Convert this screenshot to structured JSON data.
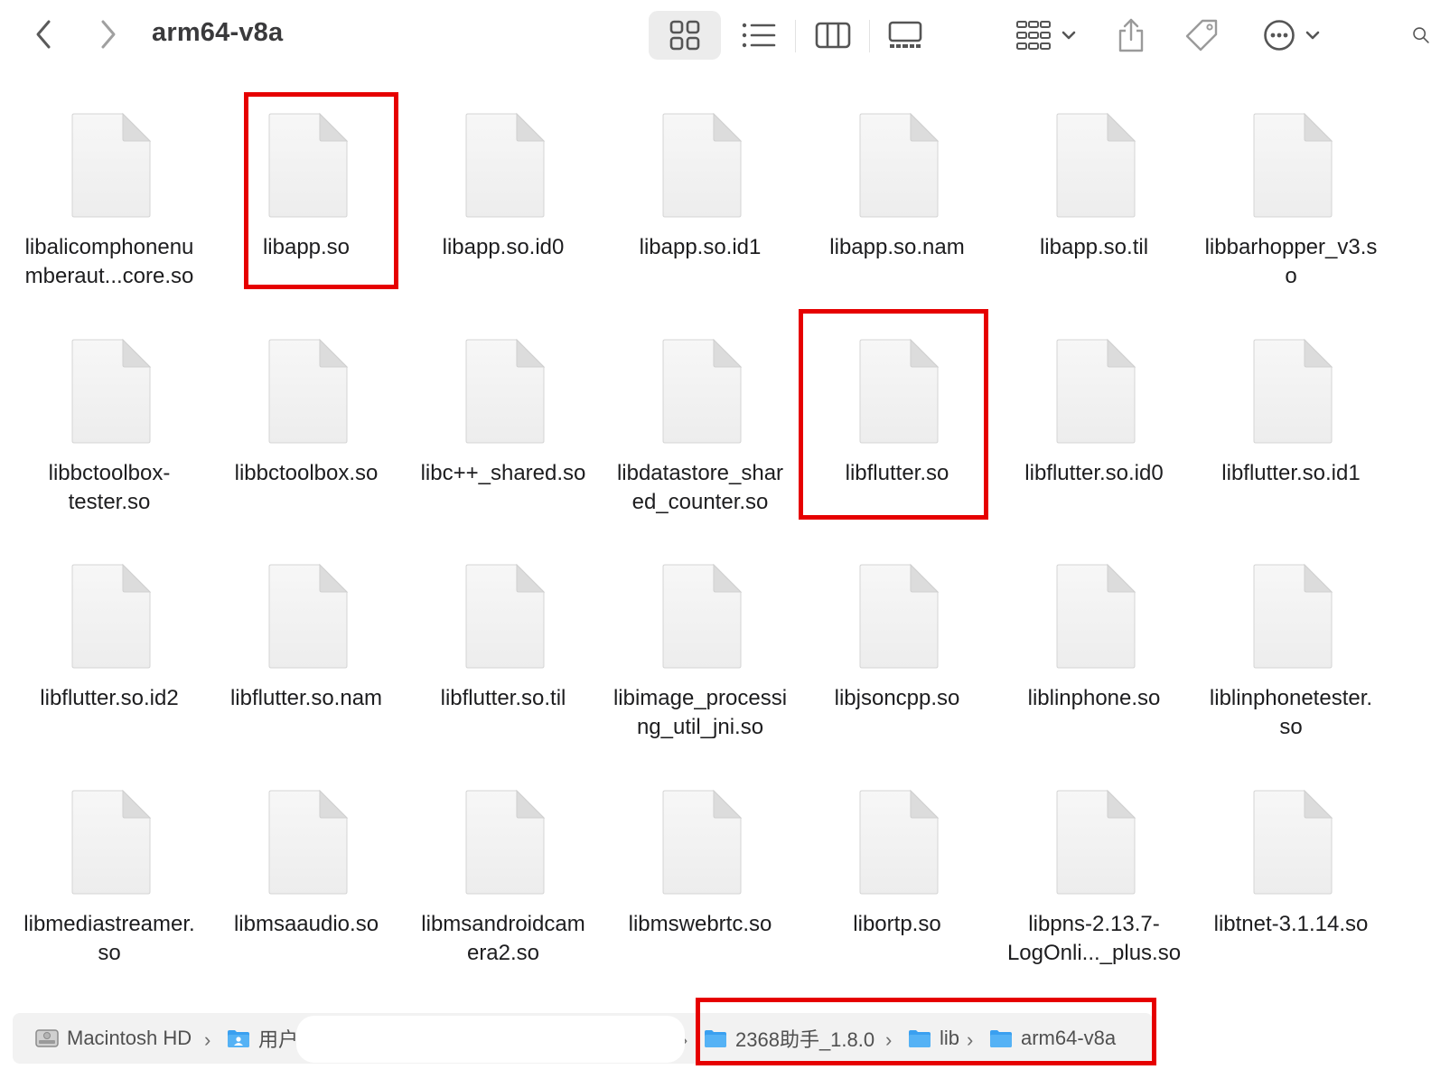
{
  "window": {
    "title": "arm64-v8a"
  },
  "toolbar": {
    "back_icon": "chevron-left-icon",
    "forward_icon": "chevron-right-icon",
    "views": [
      "icon-view",
      "list-view",
      "column-view",
      "gallery-view"
    ],
    "active_view": "icon-view",
    "group_icon": "group-grid-icon",
    "share_icon": "share-icon",
    "tag_icon": "tag-icon",
    "more_icon": "ellipsis-circle-icon",
    "search_icon": "search-icon"
  },
  "files": [
    "libalicomphonenu mberaut...core.so",
    "libapp.so",
    "libapp.so.id0",
    "libapp.so.id1",
    "libapp.so.nam",
    "libapp.so.til",
    "libbarhopper_v3.so",
    "libbctoolbox-tester.so",
    "libbctoolbox.so",
    "libc++_shared.so",
    "libdatastore_shared_counter.so",
    "libflutter.so",
    "libflutter.so.id0",
    "libflutter.so.id1",
    "libflutter.so.id2",
    "libflutter.so.nam",
    "libflutter.so.til",
    "libimage_processing_util_jni.so",
    "libjsoncpp.so",
    "liblinphone.so",
    "liblinphonetester.so",
    "libmediastreamer.so",
    "libmsaaudio.so",
    "libmsandroidcamera2.so",
    "libmswebrtc.so",
    "libortp.so",
    "libpns-2.13.7-LogOnli..._plus.so",
    "libtnet-3.1.14.so"
  ],
  "file_labels": [
    [
      "libalicomphonenu",
      "mberaut...core.so"
    ],
    [
      "libapp.so"
    ],
    [
      "libapp.so.id0"
    ],
    [
      "libapp.so.id1"
    ],
    [
      "libapp.so.nam"
    ],
    [
      "libapp.so.til"
    ],
    [
      "libbarhopper_v3.s",
      "o"
    ],
    [
      "libbctoolbox-",
      "tester.so"
    ],
    [
      "libbctoolbox.so"
    ],
    [
      "libc++_shared.so"
    ],
    [
      "libdatastore_shar",
      "ed_counter.so"
    ],
    [
      "libflutter.so"
    ],
    [
      "libflutter.so.id0"
    ],
    [
      "libflutter.so.id1"
    ],
    [
      "libflutter.so.id2"
    ],
    [
      "libflutter.so.nam"
    ],
    [
      "libflutter.so.til"
    ],
    [
      "libimage_processi",
      "ng_util_jni.so"
    ],
    [
      "libjsoncpp.so"
    ],
    [
      "liblinphone.so"
    ],
    [
      "liblinphonetester.",
      "so"
    ],
    [
      "libmediastreamer.",
      "so"
    ],
    [
      "libmsaaudio.so"
    ],
    [
      "libmsandroidcam",
      "era2.so"
    ],
    [
      "libmswebrtc.so"
    ],
    [
      "libortp.so"
    ],
    [
      "libpns-2.13.7-",
      "LogOnli..._plus.so"
    ],
    [
      "libtnet-3.1.14.so"
    ]
  ],
  "highlighted_files": [
    "libapp.so",
    "libflutter.so"
  ],
  "highlight_color": "#e60000",
  "pathbar": {
    "items": [
      {
        "label": "Macintosh HD",
        "icon": "hard-drive-icon"
      },
      {
        "label": "用户",
        "icon": "users-folder-icon"
      },
      {
        "label": "2368助手_1.8.0",
        "icon": "folder-icon"
      },
      {
        "label": "lib",
        "icon": "folder-icon"
      },
      {
        "label": "arm64-v8a",
        "icon": "folder-icon"
      }
    ]
  },
  "colors": {
    "folder_blue": "#3aa0f0",
    "toolbar_icon": "#5a5a5a",
    "active_view_bg": "#ececec"
  }
}
